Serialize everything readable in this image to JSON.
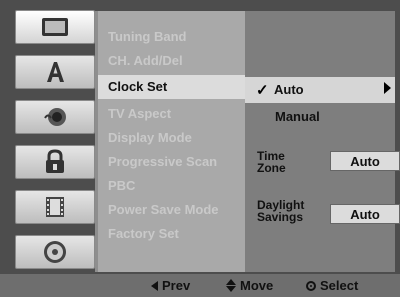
{
  "tabs": [
    {
      "icon": "monitor-icon"
    },
    {
      "icon": "language-a-icon"
    },
    {
      "icon": "speaker-icon"
    },
    {
      "icon": "lock-icon"
    },
    {
      "icon": "film-icon"
    },
    {
      "icon": "disc-icon"
    }
  ],
  "menu": {
    "items": [
      "Tuning Band",
      "CH. Add/Del",
      "Clock Set",
      "TV Aspect",
      "Display Mode",
      "Progressive Scan",
      "PBC",
      "Power Save Mode",
      "Factory Set"
    ],
    "selected": "Clock Set"
  },
  "settings": {
    "options": [
      "Auto",
      "Manual"
    ],
    "selected_option": "Auto",
    "time_zone_label_1": "Time",
    "time_zone_label_2": "Zone",
    "time_zone_value": "Auto",
    "daylight_label_1": "Daylight",
    "daylight_label_2": "Savings",
    "daylight_value": "Auto"
  },
  "bottom_bar": {
    "prev": "Prev",
    "move": "Move",
    "select": "Select"
  },
  "colors": {
    "menu_bg": "#a9a9a9",
    "pane_bg": "#7e7e7e",
    "highlight": "#dcdcdc"
  }
}
